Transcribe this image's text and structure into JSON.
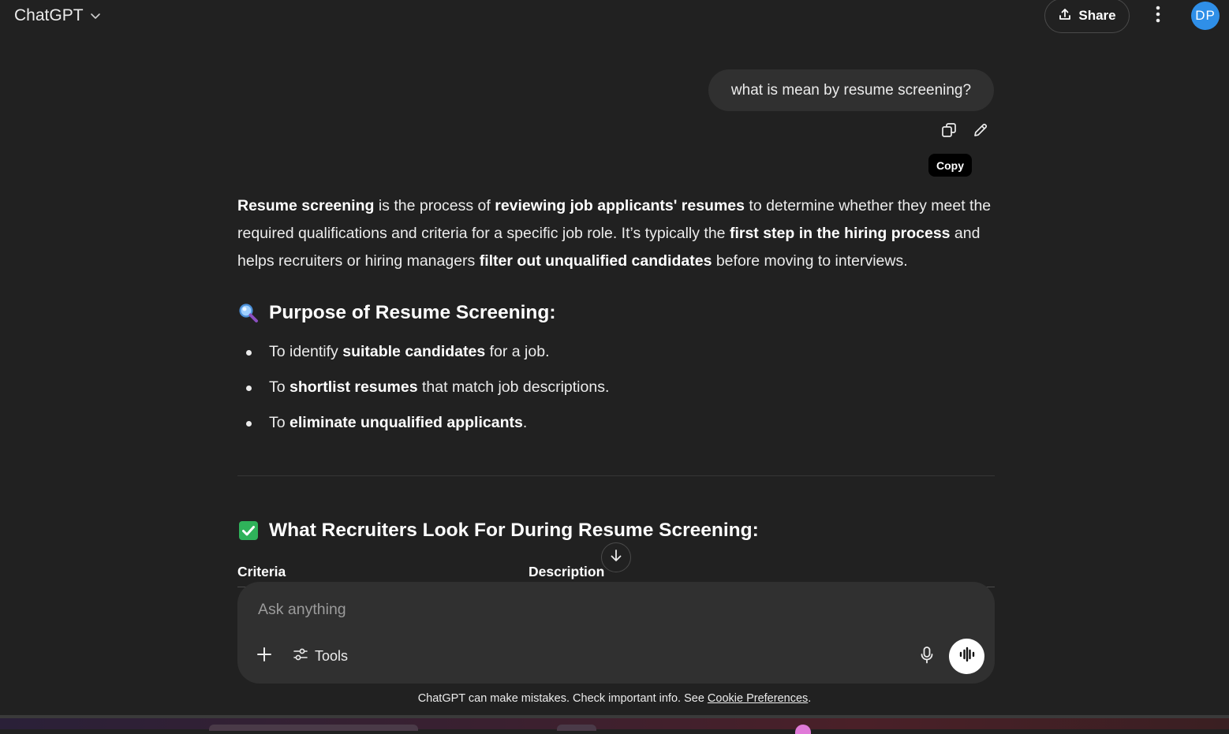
{
  "header": {
    "model_name": "ChatGPT",
    "share_label": "Share",
    "avatar_initials": "DP",
    "icons": [
      "chevron-down-icon",
      "share-upload-icon",
      "more-vertical-icon"
    ]
  },
  "conversation": {
    "user_message": "what is mean by resume screening?",
    "message_actions": [
      "copy-icon",
      "edit-icon"
    ],
    "tooltip": "Copy",
    "answer": {
      "intro": [
        {
          "text": "Resume screening",
          "bold": true
        },
        {
          "text": " is the process of ",
          "bold": false
        },
        {
          "text": "reviewing job applicants' resumes",
          "bold": true
        },
        {
          "text": " to determine whether they meet the required qualifications and criteria for a specific job role. It’s typically the ",
          "bold": false
        },
        {
          "text": "first step in the hiring process",
          "bold": true
        },
        {
          "text": " and helps recruiters or hiring managers ",
          "bold": false
        },
        {
          "text": "filter out unqualified candidates",
          "bold": true
        },
        {
          "text": " before moving to interviews.",
          "bold": false
        }
      ],
      "section1": {
        "emoji": "magnifying-glass-icon",
        "title": "Purpose of Resume Screening:",
        "bullets": [
          [
            {
              "text": "To identify ",
              "bold": false
            },
            {
              "text": "suitable candidates",
              "bold": true
            },
            {
              "text": " for a job.",
              "bold": false
            }
          ],
          [
            {
              "text": "To ",
              "bold": false
            },
            {
              "text": "shortlist resumes",
              "bold": true
            },
            {
              "text": " that match job descriptions.",
              "bold": false
            }
          ],
          [
            {
              "text": "To ",
              "bold": false
            },
            {
              "text": "eliminate unqualified applicants",
              "bold": true
            },
            {
              "text": ".",
              "bold": false
            }
          ]
        ]
      },
      "section2": {
        "emoji": "check-mark-icon",
        "title": "What Recruiters Look For During Resume Screening:",
        "table_headers": [
          "Criteria",
          "Description"
        ]
      }
    }
  },
  "composer": {
    "placeholder": "Ask anything",
    "tools_label": "Tools"
  },
  "footer": {
    "disclaimer": "ChatGPT can make mistakes. Check important info. See ",
    "link_label": "Cookie Preferences",
    "disclaimer_end": "."
  },
  "colors": {
    "background": "#212121",
    "bubble": "#303030",
    "avatar": "#2f8fe8",
    "check_green": "#2fb25a",
    "magnifier_blue": "#5aa8f0"
  }
}
